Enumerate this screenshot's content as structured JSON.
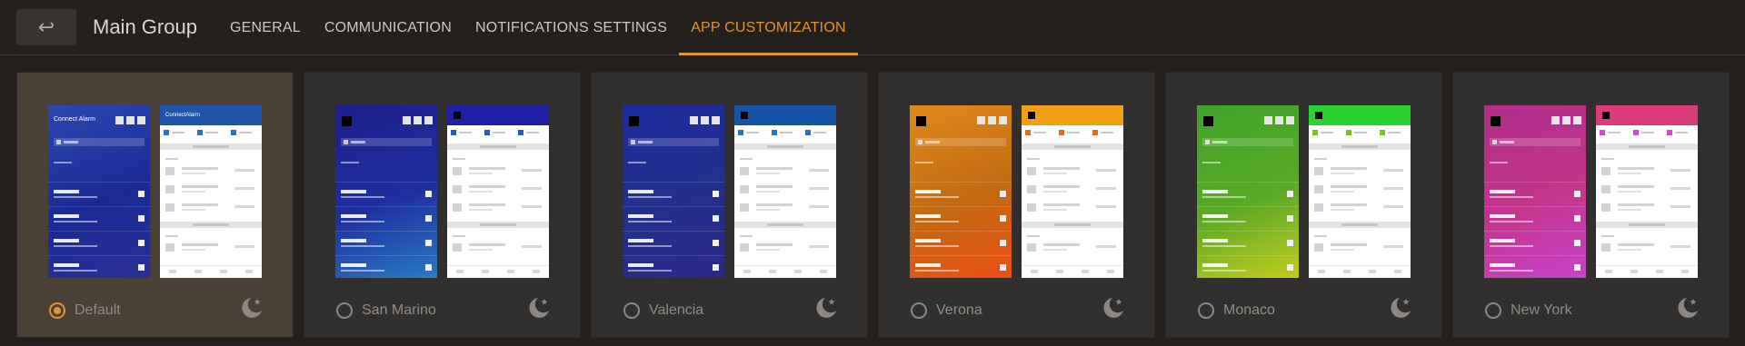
{
  "header": {
    "back_icon": "arrow-back-icon",
    "back_glyph": "↩",
    "title": "Main Group",
    "tabs": [
      {
        "label": "GENERAL",
        "active": false
      },
      {
        "label": "COMMUNICATION",
        "active": false
      },
      {
        "label": "NOTIFICATIONS SETTINGS",
        "active": false
      },
      {
        "label": "APP CUSTOMIZATION",
        "active": true
      }
    ],
    "accent_color": "#e8922a"
  },
  "themes": [
    {
      "name": "Default",
      "selected": true,
      "logo_text": "Connect Alarm",
      "light_logo_text": "ConnectAlarm",
      "gradient": [
        "#2a47b0",
        "#1a2a95",
        "#2a2f96"
      ],
      "light_header": "#1d56a8",
      "check": "#2d6fd0"
    },
    {
      "name": "San Marino",
      "selected": false,
      "gradient": [
        "#1d1f8c",
        "#1e2fa0",
        "#2a7bc4"
      ],
      "light_header": "#1f20a6",
      "check": "#2f56c9"
    },
    {
      "name": "Valencia",
      "selected": false,
      "gradient": [
        "#1d2c9e",
        "#22308c",
        "#2b2a86"
      ],
      "light_header": "#1553a6",
      "check": "#2b6fd0"
    },
    {
      "name": "Verona",
      "selected": false,
      "gradient": [
        "#e08a1c",
        "#c26a12",
        "#ec4e13"
      ],
      "light_header": "#f0a010",
      "check": "#e86a20"
    },
    {
      "name": "Monaco",
      "selected": false,
      "gradient": [
        "#3ea42a",
        "#5aaa26",
        "#c2cc1e"
      ],
      "light_header": "#2bd130",
      "check": "#7cc322"
    },
    {
      "name": "New York",
      "selected": false,
      "gradient": [
        "#b02d8a",
        "#c4358c",
        "#c742c8"
      ],
      "light_header": "#db3b78",
      "check": "#c84bd0"
    }
  ],
  "moon_icon": "dark-mode-moon-icon"
}
